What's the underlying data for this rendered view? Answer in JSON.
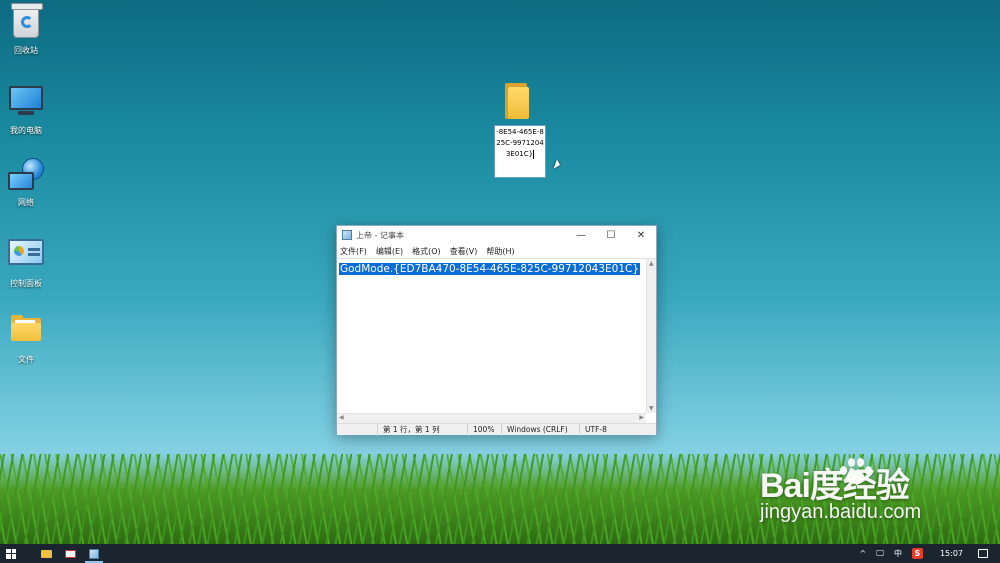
{
  "desktop": {
    "icons": [
      {
        "label": "回收站",
        "icon": "recycle-bin-icon"
      },
      {
        "label": "我的电脑",
        "icon": "computer-icon"
      },
      {
        "label": "网络",
        "icon": "network-icon"
      },
      {
        "label": "控制面板",
        "icon": "control-panel-icon"
      },
      {
        "label": "文件",
        "icon": "folder-icon"
      }
    ],
    "renaming_folder": {
      "text": "-8E54-465E-825C-99712043E01C}",
      "icon": "folder-icon"
    }
  },
  "notepad": {
    "title": "上帝 - 记事本",
    "menu": [
      "文件(F)",
      "编辑(E)",
      "格式(O)",
      "查看(V)",
      "帮助(H)"
    ],
    "content": "GodMode.{ED7BA470-8E54-465E-825C-99712043E01C}",
    "status": {
      "position": "第 1 行，第 1 列",
      "zoom": "100%",
      "line_ending": "Windows (CRLF)",
      "encoding": "UTF-8"
    },
    "controls": {
      "minimize": "—",
      "maximize": "☐",
      "close": "✕"
    }
  },
  "taskbar": {
    "apps": [
      "file-explorer-icon",
      "mail-icon",
      "notepad-icon"
    ],
    "tray": {
      "chevron": "^",
      "ime": "中",
      "ime_logo": "S",
      "time": "15:07"
    }
  },
  "watermark": {
    "logo": "Bai度经验",
    "url": "jingyan.baidu.com"
  }
}
